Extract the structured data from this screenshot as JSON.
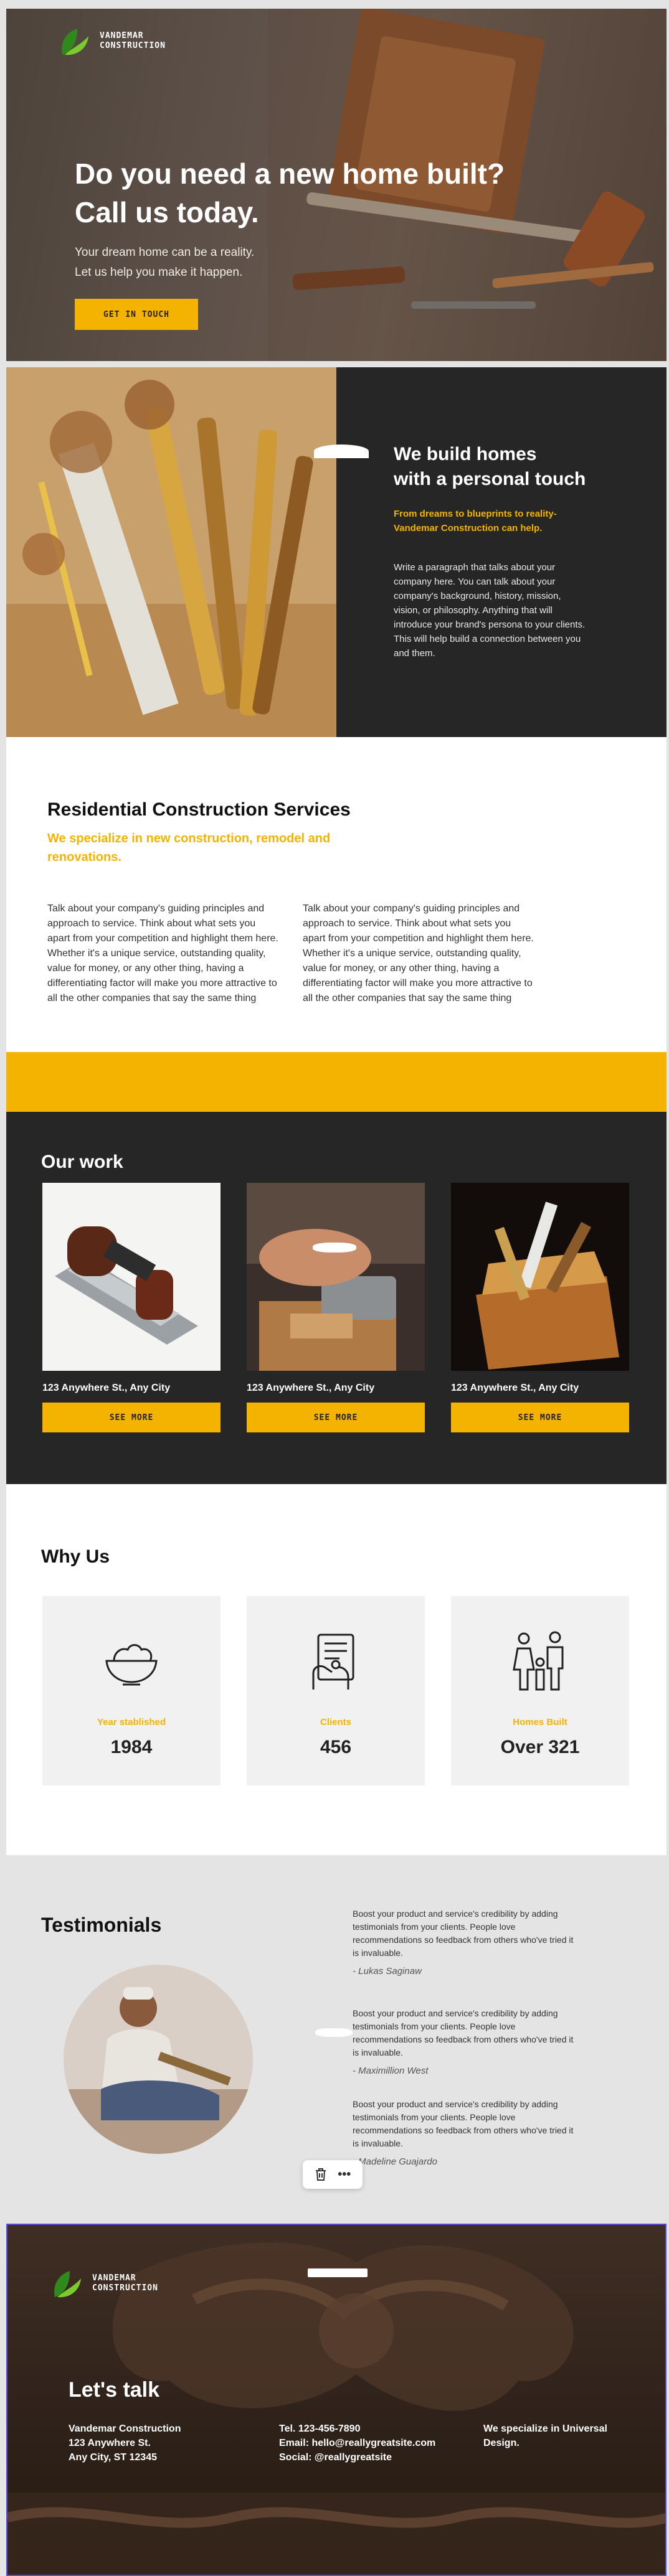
{
  "brand": {
    "name_line1": "VANDEMAR",
    "name_line2": "CONSTRUCTION",
    "leaf_dark": "#2f8a1e",
    "leaf_light": "#7ccb2e"
  },
  "colors": {
    "accent": "#f5b301",
    "dark": "#262626"
  },
  "hero": {
    "title_line1": "Do you need a new home built?",
    "title_line2": "Call us today.",
    "sub_line1": "Your dream home can be a reality.",
    "sub_line2": "Let us help you make it happen.",
    "cta": "GET IN TOUCH"
  },
  "about": {
    "title_line1": "We build homes",
    "title_line2": "with a personal touch",
    "tagline": "From dreams to blueprints to reality- Vandemar Construction can help.",
    "paragraph": "Write a paragraph that talks about your company here. You can talk about your company's background, history, mission, vision, or philosophy. Anything that will introduce your brand's persona to your clients. This will help build a connection between you and them."
  },
  "services": {
    "title": "Residential Construction Services",
    "tagline": "We specialize in new construction, remodel and renovations.",
    "col1": "Talk about your company's guiding principles and approach to service. Think about what sets you apart from your competition and highlight them here. Whether it's a unique service, outstanding quality, value for money, or any other thing, having a differentiating factor will make you more attractive to all the other companies that say the same thing",
    "col2": "Talk about your company's guiding principles and approach to service. Think about what sets you apart from your competition and highlight them here. Whether it's a unique service, outstanding quality, value for money, or any other thing, having a differentiating factor will make you more attractive to all the other companies that say the same thing"
  },
  "work": {
    "title": "Our work",
    "cards": [
      {
        "address": "123 Anywhere St., Any City",
        "button": "SEE MORE",
        "image": "hand-plane-photo"
      },
      {
        "address": "123 Anywhere St., Any City",
        "button": "SEE MORE",
        "image": "planing-wood-photo"
      },
      {
        "address": "123 Anywhere St., Any City",
        "button": "SEE MORE",
        "image": "toolbox-photo"
      }
    ]
  },
  "why": {
    "title": "Why Us",
    "stats": [
      {
        "label": "Year stablished",
        "value": "1984",
        "icon": "bowl-icon"
      },
      {
        "label": "Clients",
        "value": "456",
        "icon": "client-form-icon"
      },
      {
        "label": "Homes Built",
        "value": "Over 321",
        "icon": "family-icon"
      }
    ]
  },
  "testimonials": {
    "title": "Testimonials",
    "items": [
      {
        "text": "Boost your product and service's credibility by adding testimonials from your clients. People love recommendations so feedback from others who've tried it is invaluable.",
        "author": "- Lukas Saginaw"
      },
      {
        "text": "Boost your product and service's credibility by adding testimonials from your clients. People love recommendations so feedback from others who've tried it is invaluable.",
        "author": "- Maximillion West"
      },
      {
        "text": "Boost your product and service's credibility by adding testimonials from your clients. People love recommendations so feedback from others who've tried it is invaluable.",
        "author": "- Madeline Guajardo"
      }
    ],
    "toolbar": {
      "delete_icon": "trash-icon",
      "more_icon": "more-icon",
      "more_glyph": "•••"
    }
  },
  "footer": {
    "title": "Let's talk",
    "company": "Vandemar Construction",
    "street": "123 Anywhere St.",
    "city": "Any City, ST 12345",
    "tel": "Tel. 123-456-7890",
    "email": "Email: hello@reallygreatsite.com",
    "social": "Social: @reallygreatsite",
    "specialty": "We specialize in Universal Design."
  }
}
